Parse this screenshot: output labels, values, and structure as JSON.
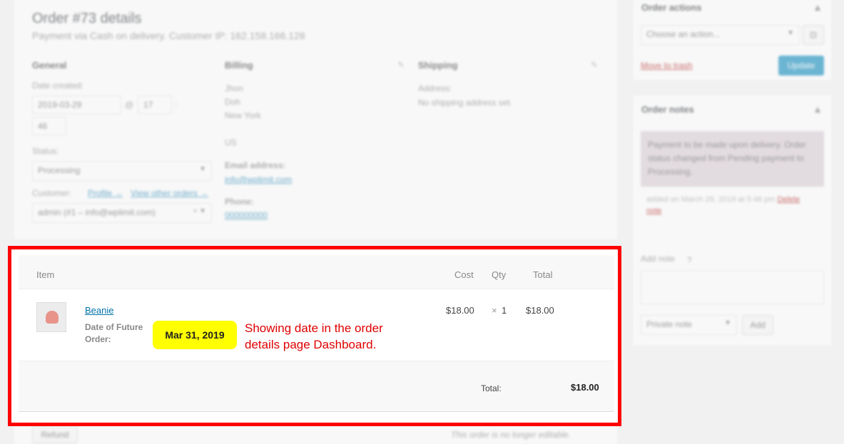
{
  "order": {
    "title": "Order #73 details",
    "subtitle": "Payment via Cash on delivery. Customer IP: 162.158.166.128",
    "general": {
      "heading": "General",
      "date_label": "Date created:",
      "date_value": "2019-03-29",
      "at": "@",
      "hour": "17",
      "minute_sep": ":",
      "minute": "46",
      "status_label": "Status:",
      "status_value": "Processing",
      "customer_label": "Customer:",
      "profile_link": "Profile →",
      "other_orders_link": "View other orders →",
      "customer_value": "admin (#1 – info@wplimit.com)"
    },
    "billing": {
      "heading": "Billing",
      "address": [
        "Jhon",
        "Doh",
        "New York",
        "",
        "US"
      ],
      "email_label": "Email address:",
      "email": "info@wplimit.com",
      "phone_label": "Phone:",
      "phone": "000000000"
    },
    "shipping": {
      "heading": "Shipping",
      "address_label": "Address:",
      "address_value": "No shipping address set."
    }
  },
  "items": {
    "headers": {
      "item": "Item",
      "cost": "Cost",
      "qty": "Qty",
      "total": "Total"
    },
    "rows": [
      {
        "name": "Beanie",
        "meta_label": "Date of Future Order:",
        "meta_value": "Mar 31, 2019",
        "cost": "$18.00",
        "qty_x": "×",
        "qty": "1",
        "total": "$18.00"
      }
    ],
    "total_label": "Total:",
    "total_value": "$18.00",
    "refund_label": "Refund",
    "not_editable": "This order is no longer editable."
  },
  "annotation": "Showing date in the order details page Dashboard.",
  "sidebar": {
    "actions": {
      "title": "Order actions",
      "select_placeholder": "Choose an action...",
      "trash": "Move to trash",
      "update": "Update"
    },
    "notes": {
      "title": "Order notes",
      "note_text": "Payment to be made upon delivery. Order status changed from Pending payment to Processing.",
      "note_meta": "added on March 29, 2019 at 5:46 pm",
      "delete": "Delete note",
      "add_label": "Add note",
      "type_value": "Private note",
      "add_button": "Add"
    }
  },
  "colors": {
    "highlight_border": "#ff0000",
    "badge_bg": "#ffff00",
    "annotation_text": "#e00000",
    "link": "#0073aa",
    "primary_button": "#0085ba"
  }
}
